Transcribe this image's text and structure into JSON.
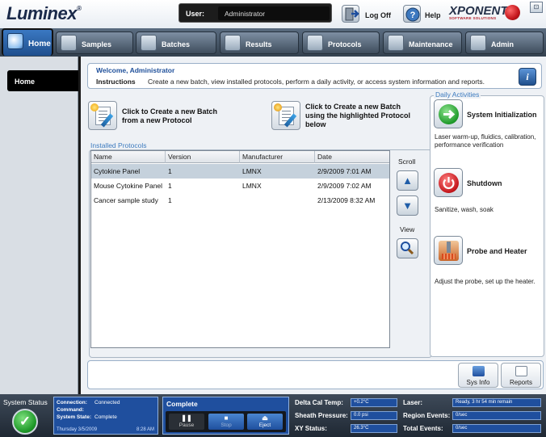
{
  "app": {
    "logo_text": "Luminex",
    "logo_mark": "®"
  },
  "header": {
    "user_label": "User:",
    "user_value": "Administrator",
    "logoff_label": "Log Off",
    "help_label": "Help",
    "brand": "XPONENT",
    "brand_tagline": "SOFTWARE SOLUTIONS",
    "window_control": "⊡"
  },
  "tabs": [
    {
      "label": "Home",
      "icon": "home-icon"
    },
    {
      "label": "Samples",
      "icon": "samples-icon"
    },
    {
      "label": "Batches",
      "icon": "batches-icon"
    },
    {
      "label": "Results",
      "icon": "results-icon"
    },
    {
      "label": "Protocols",
      "icon": "protocols-icon"
    },
    {
      "label": "Maintenance",
      "icon": "maintenance-icon"
    },
    {
      "label": "Admin",
      "icon": "admin-icon"
    }
  ],
  "sidebar": {
    "items": [
      {
        "label": "Home"
      }
    ]
  },
  "welcome": {
    "greeting": "Welcome, Administrator",
    "instructions_label": "Instructions",
    "instructions_text": "Create a new batch, view installed protocols, perform a daily activity, or access system information and reports."
  },
  "create": {
    "new_batch_new_protocol": "Click to Create a new Batch from a new Protocol",
    "new_batch_highlighted": "Click to Create a new Batch using the highlighted Protocol below"
  },
  "installed_protocols": {
    "title": "Installed Protocols",
    "columns": [
      "Name",
      "Version",
      "Manufacturer",
      "Date"
    ],
    "rows": [
      {
        "name": "Cytokine Panel",
        "version": "1",
        "manufacturer": "LMNX",
        "date": "2/9/2009 7:01 AM",
        "selected": true
      },
      {
        "name": "Mouse Cytokine Panel",
        "version": "1",
        "manufacturer": "LMNX",
        "date": "2/9/2009 7:02 AM",
        "selected": false
      },
      {
        "name": "Cancer sample study",
        "version": "1",
        "manufacturer": "",
        "date": "2/13/2009 8:32 AM",
        "selected": false
      }
    ],
    "scroll_label": "Scroll",
    "view_label": "View"
  },
  "daily_activities": {
    "title": "Daily Activities",
    "items": [
      {
        "title": "System Initialization",
        "desc": "Laser warm-up, fluidics, calibration, performance verification",
        "icon": "system-initialization-icon"
      },
      {
        "title": "Shutdown",
        "desc": "Sanitize, wash, soak",
        "icon": "shutdown-icon"
      },
      {
        "title": "Probe and Heater",
        "desc": "Adjust the probe, set up the heater.",
        "icon": "probe-heater-icon"
      }
    ]
  },
  "actionbar": {
    "sysinfo_label": "Sys Info",
    "reports_label": "Reports"
  },
  "status": {
    "system_status_label": "System Status",
    "connection_key": "Connection:",
    "connection_val": "Connected",
    "command_key": "Command:",
    "command_val": "",
    "state_key": "System State:",
    "state_val": "Complete",
    "date": "Thursday 3/5/2009",
    "time": "8:28 AM",
    "complete_label": "Complete",
    "pause_label": "Pause",
    "stop_label": "Stop",
    "eject_label": "Eject",
    "delta_cal_key": "Delta Cal Temp:",
    "delta_cal_val": "+0.2°C",
    "sheath_key": "Sheath Pressure:",
    "sheath_val": "0.0 psi",
    "xy_key": "XY Status:",
    "xy_val": "26.3°C",
    "laser_key": "Laser:",
    "laser_val": "Ready, 3 hr 54 min remain",
    "region_key": "Region Events:",
    "region_val": "0/sec",
    "total_key": "Total Events:",
    "total_val": "0/sec"
  },
  "colors": {
    "accent": "#1f4f9e",
    "selected_row": "#c5d1dc",
    "ok_green": "#1f9a2a",
    "shutdown_red": "#c4161c"
  }
}
